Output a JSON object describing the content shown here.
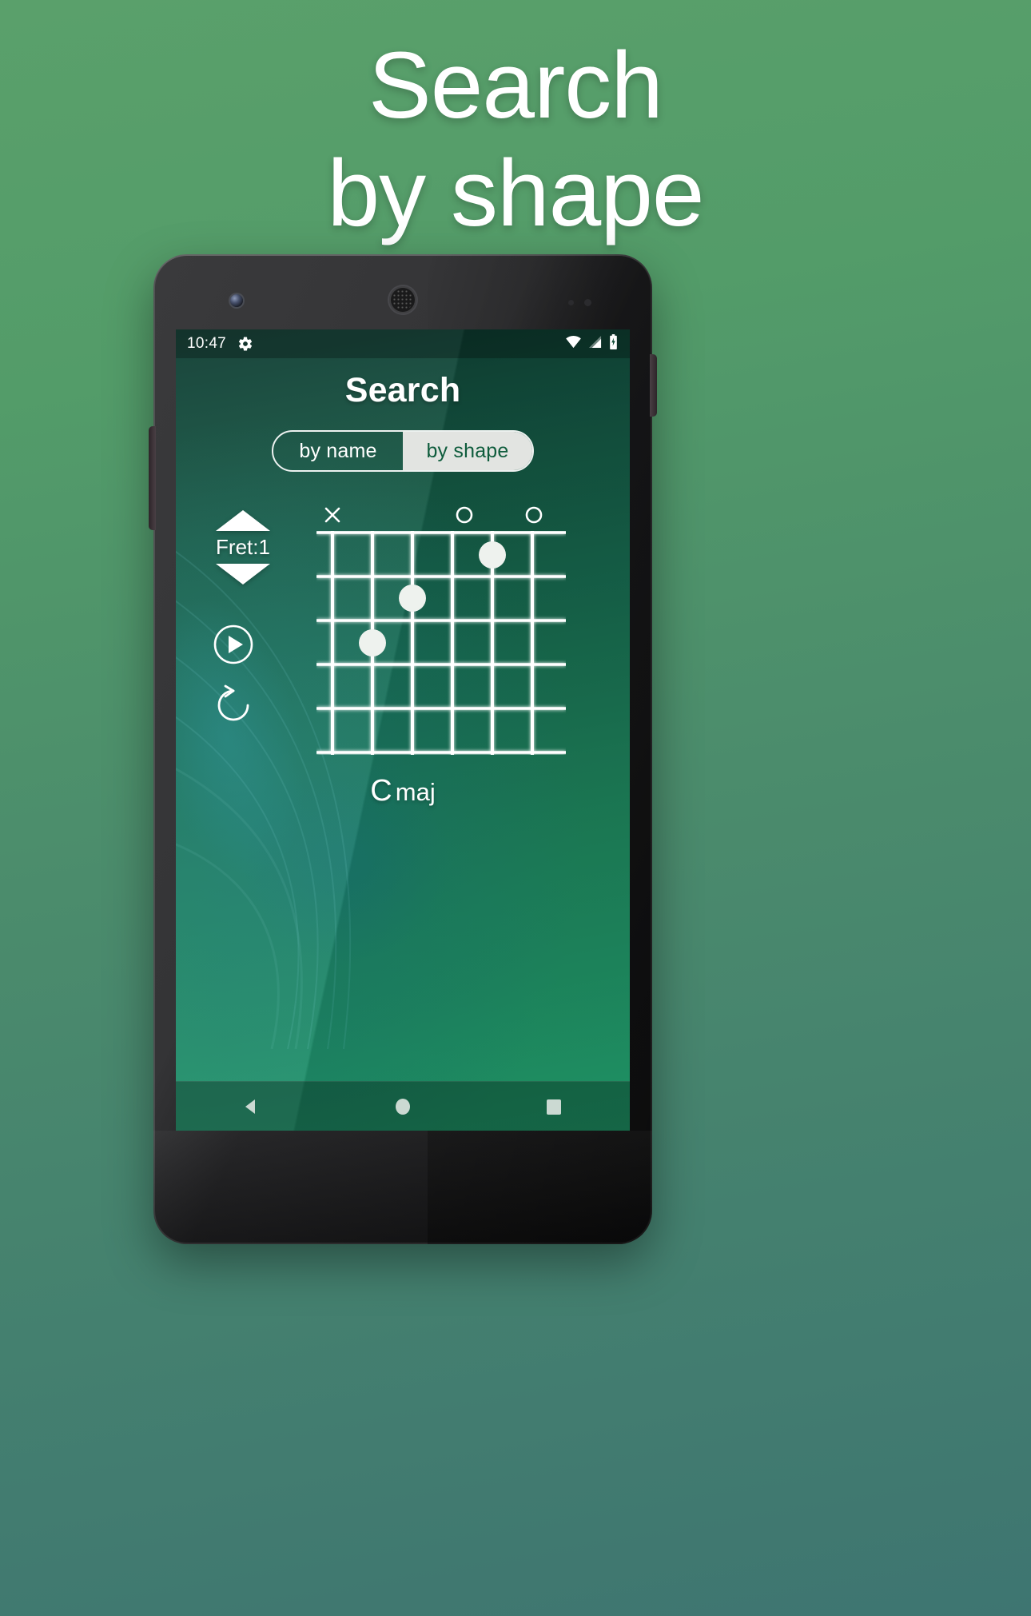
{
  "promo": {
    "headline": "Search\nby shape",
    "bg_top_color": "#539C69",
    "bg_bottom_color": "#3E7571"
  },
  "phone": {
    "device_hardware": {
      "camera": "front-camera",
      "earpiece": "earpiece-speaker",
      "power_button": "power-button",
      "volume_button": "volume-button"
    }
  },
  "statusbar": {
    "time": "10:47",
    "icons": [
      "gear-icon",
      "wifi-icon",
      "cellular-signal-icon",
      "battery-charging-icon"
    ]
  },
  "app": {
    "title": "Search",
    "segmented_control": {
      "options": [
        {
          "label": "by name",
          "selected": false
        },
        {
          "label": "by shape",
          "selected": true
        }
      ],
      "selected_bg": "#E2E4E1",
      "selected_fg": "#0E5C3C"
    },
    "fret_control": {
      "increase_label": "increase-fret",
      "label": "Fret:1",
      "decrease_label": "decrease-fret"
    },
    "actions": [
      {
        "name": "play-button",
        "icon": "play-icon"
      },
      {
        "name": "reset-button",
        "icon": "reset-icon"
      }
    ],
    "chord": {
      "strings": 6,
      "frets": 5,
      "start_fret": 1,
      "open_mute_markers": [
        "x",
        "",
        "",
        "o",
        "",
        "o"
      ],
      "dots": [
        {
          "string": 5,
          "fret": 1
        },
        {
          "string": 3,
          "fret": 2
        },
        {
          "string": 2,
          "fret": 3
        }
      ],
      "root": "C",
      "quality": "maj"
    }
  },
  "navbar": {
    "items": [
      {
        "name": "nav-back",
        "icon": "back-triangle-icon"
      },
      {
        "name": "nav-home",
        "icon": "home-circle-icon"
      },
      {
        "name": "nav-recents",
        "icon": "recents-square-icon"
      }
    ]
  }
}
